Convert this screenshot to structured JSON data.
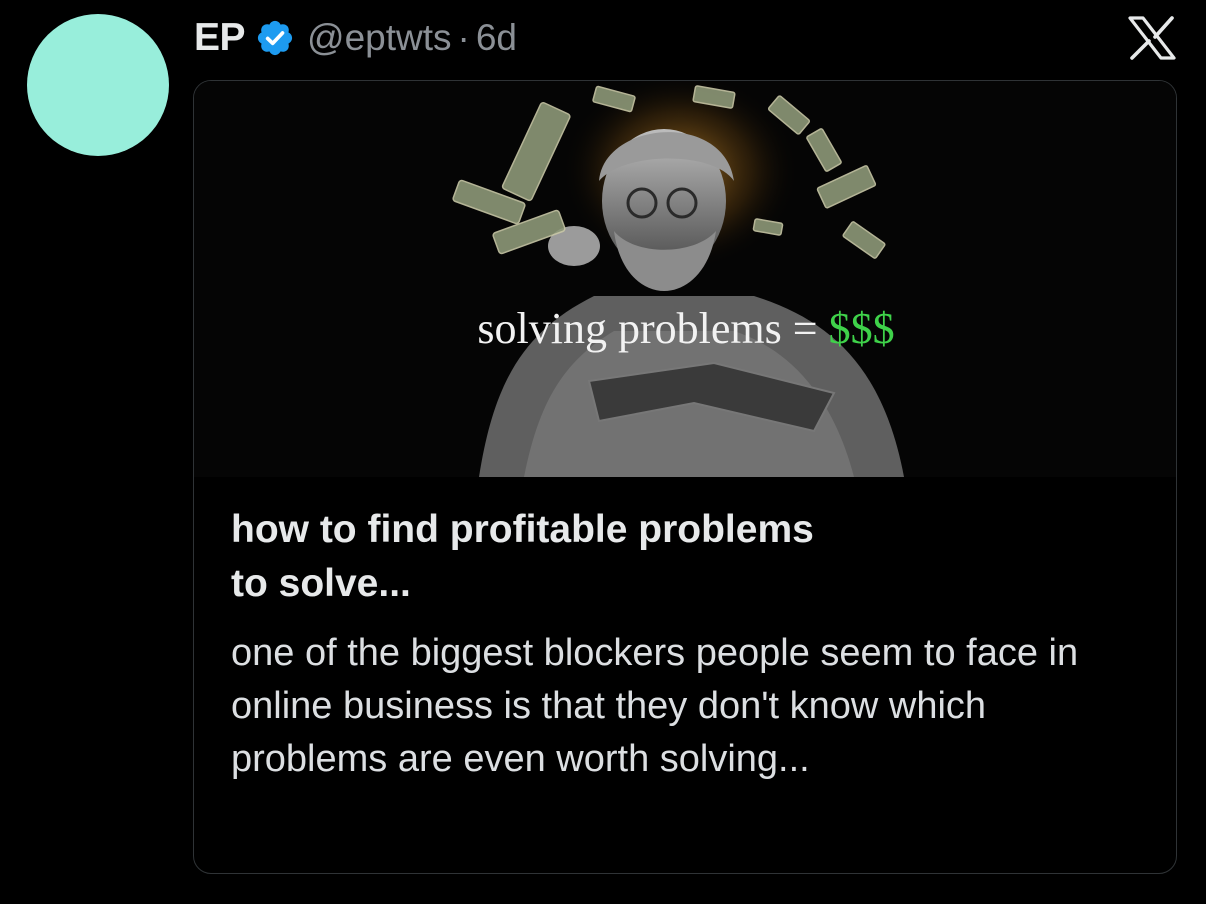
{
  "tweet": {
    "author": {
      "display_name": "EP",
      "handle": "@eptwts",
      "separator": "·",
      "time": "6d",
      "avatar_color": "#98eedb",
      "verified_color": "#1d9bf0"
    },
    "brand_icon": "x-logo-icon",
    "card": {
      "image": {
        "overlay_text": "solving problems = ",
        "overlay_money": "$$$",
        "money_color": "#3fd24a"
      },
      "title_line1": "how to find profitable problems",
      "title_line2": "to solve...",
      "description": "one of the biggest blockers people seem to face in online business is that they don't know which problems are even worth solving..."
    }
  }
}
